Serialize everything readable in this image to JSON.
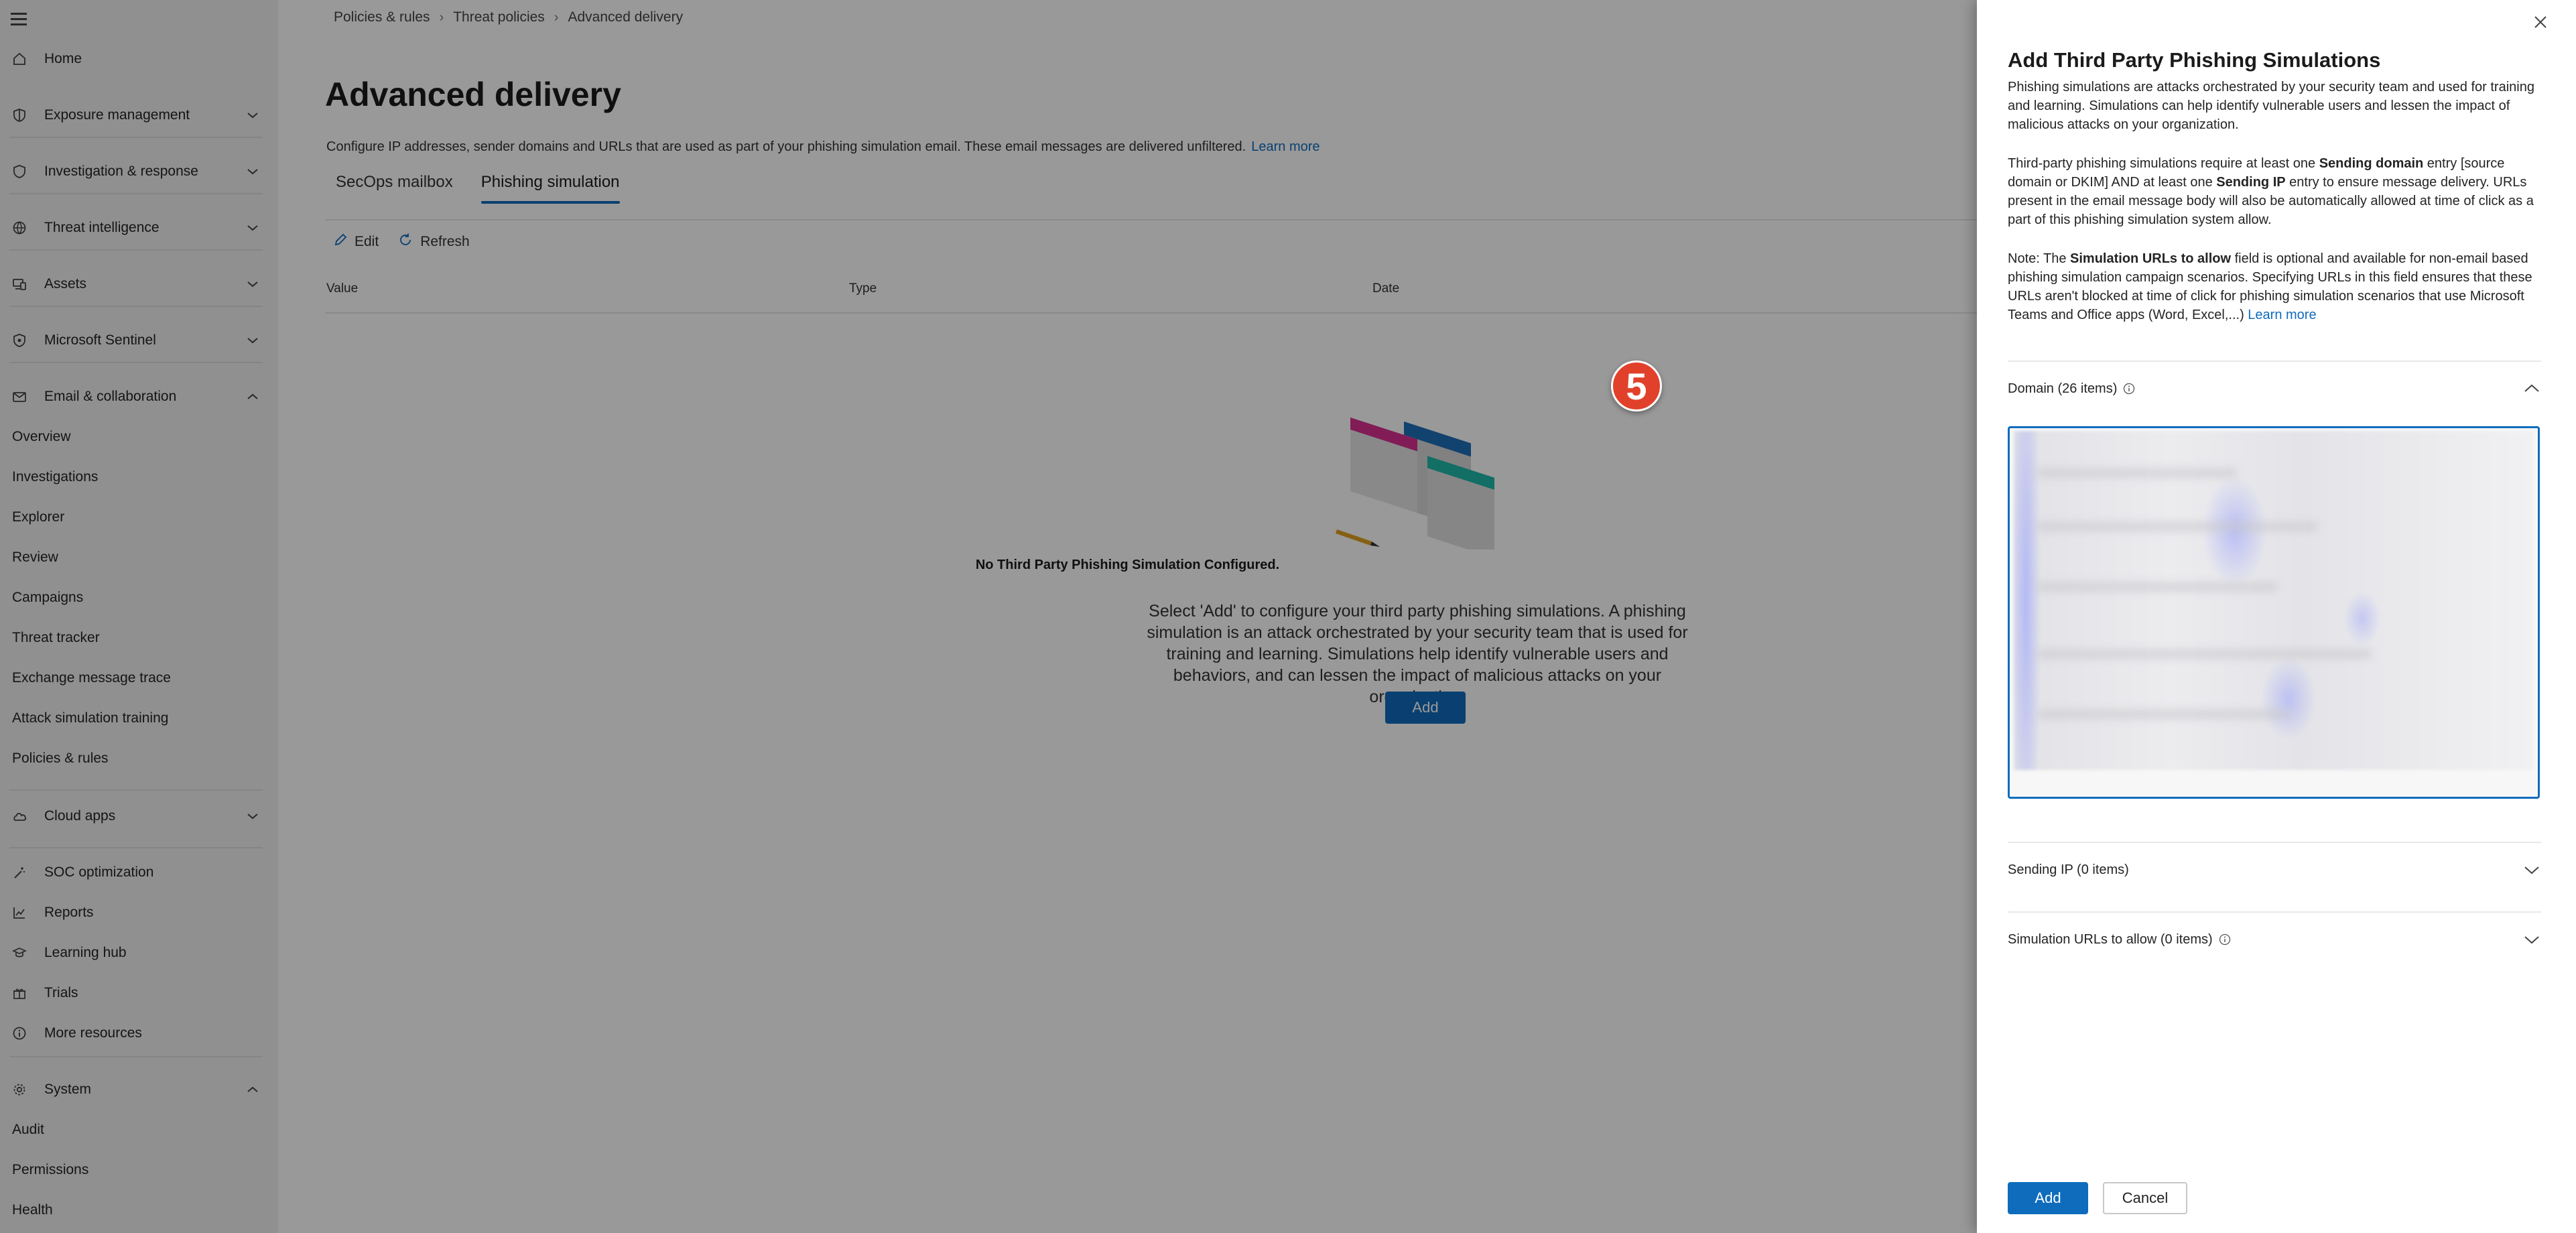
{
  "nav": {
    "items": [
      {
        "label": "Home",
        "icon": "home-icon"
      },
      {
        "label": "Exposure management",
        "icon": "shield-half-icon",
        "chevron": "down"
      },
      {
        "label": "Investigation & response",
        "icon": "shield-icon",
        "chevron": "down"
      },
      {
        "label": "Threat intelligence",
        "icon": "globe-icon",
        "chevron": "down"
      },
      {
        "label": "Assets",
        "icon": "devices-icon",
        "chevron": "down"
      },
      {
        "label": "Microsoft Sentinel",
        "icon": "sentinel-icon",
        "chevron": "down"
      },
      {
        "label": "Email & collaboration",
        "icon": "mail-icon",
        "chevron": "up"
      },
      {
        "label": "Cloud apps",
        "icon": "cloud-icon",
        "chevron": "down"
      },
      {
        "label": "SOC optimization",
        "icon": "wand-icon"
      },
      {
        "label": "Reports",
        "icon": "chart-icon"
      },
      {
        "label": "Learning hub",
        "icon": "learning-icon"
      },
      {
        "label": "Trials",
        "icon": "gift-icon"
      },
      {
        "label": "More resources",
        "icon": "info-icon"
      },
      {
        "label": "System",
        "icon": "gear-icon",
        "chevron": "up"
      }
    ],
    "email_sub": [
      "Overview",
      "Investigations",
      "Explorer",
      "Review",
      "Campaigns",
      "Threat tracker",
      "Exchange message trace",
      "Attack simulation training",
      "Policies & rules"
    ],
    "system_sub": [
      "Audit",
      "Permissions",
      "Health"
    ]
  },
  "breadcrumb": [
    "Policies & rules",
    "Threat policies",
    "Advanced delivery"
  ],
  "page": {
    "title": "Advanced delivery",
    "description": "Configure IP addresses, sender domains and URLs that are used as part of your phishing simulation email. These email messages are delivered unfiltered.",
    "learn_more": "Learn more",
    "tabs": [
      "SecOps mailbox",
      "Phishing simulation"
    ],
    "active_tab": "Phishing simulation",
    "commands": {
      "edit": "Edit",
      "refresh": "Refresh"
    },
    "columns": [
      "Value",
      "Type",
      "Date"
    ],
    "empty_title": "No Third Party Phishing Simulation Configured.",
    "empty_desc": "Select 'Add' to configure your third party phishing simulations. A phishing simulation is an attack orchestrated by your security team that is used for training and learning. Simulations help identify vulnerable users and behaviors, and can lessen the impact of malicious attacks on your organization.",
    "add_label": "Add"
  },
  "panel": {
    "title": "Add Third Party Phishing Simulations",
    "intro": "Phishing simulations are attacks orchestrated by your security team and used for training and learning. Simulations can help identify vulnerable users and lessen the impact of malicious attacks on your organization.",
    "req_part1": "Third-party phishing simulations require at least one ",
    "req_bold1": "Sending domain",
    "req_part2": " entry [source domain or DKIM] AND at least one ",
    "req_bold2": "Sending IP",
    "req_part3": " entry to ensure message delivery. URLs present in the email message body will also be automatically allowed at time of click as a part of this phishing simulation system allow.",
    "note_part1": "Note: The ",
    "note_bold": "Simulation URLs to allow",
    "note_part2": " field is optional and available for non-email based phishing simulation campaign scenarios. Specifying URLs in this field ensures that these URLs aren't blocked at time of click for phishing simulation scenarios that use Microsoft Teams and Office apps (Word, Excel,...) ",
    "note_learn": "Learn more",
    "domain_section": "Domain (26 items)",
    "sending_ip_section": "Sending IP (0 items)",
    "urls_section": "Simulation URLs to allow (0 items)",
    "step_badge": "5",
    "add_label": "Add",
    "cancel_label": "Cancel"
  },
  "colors": {
    "accent": "#0f6cbd",
    "badge": "#e1412b"
  }
}
